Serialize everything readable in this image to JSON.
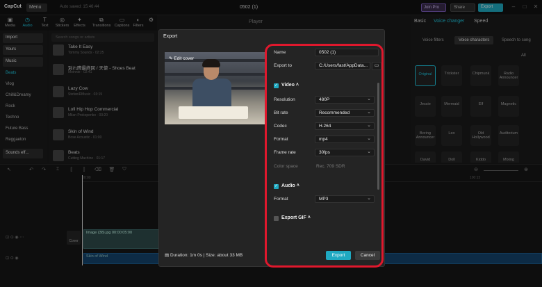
{
  "app": {
    "logo": "CapCut",
    "menu": "Menu",
    "autosave": "Auto saved: 15:46:44",
    "project_title": "0502 (1)",
    "join_pro": "Join Pro",
    "share": "Share",
    "export": "Export"
  },
  "tool_tabs": [
    {
      "label": "Media",
      "icon": "▣"
    },
    {
      "label": "Audio",
      "icon": "◷"
    },
    {
      "label": "Text",
      "icon": "T"
    },
    {
      "label": "Stickers",
      "icon": "◎"
    },
    {
      "label": "Effects",
      "icon": "✦"
    },
    {
      "label": "Transitions",
      "icon": "⧉"
    },
    {
      "label": "Captions",
      "icon": "▭"
    },
    {
      "label": "Filters",
      "icon": "◐"
    },
    {
      "label": "Adjustment",
      "icon": "⚙"
    }
  ],
  "sidebar": {
    "items": [
      "Import",
      "Yours",
      "Music",
      "Beats",
      "Vlog",
      "Chill&Dreamy",
      "Rock",
      "Techno",
      "Future Bass",
      "Reggaeton",
      "Sounds eff..."
    ]
  },
  "music": {
    "search_placeholder": "Search songs or artists",
    "tracks": [
      {
        "title": "Take It Easy",
        "sub": "Tommy Sounds · 02:25"
      },
      {
        "title": "別れ際最終回 / 天使 - Shoes Beat",
        "sub": "Moinnie · 02:41"
      },
      {
        "title": "Lazy Cow",
        "sub": "StefaniRMusic · 03:15"
      },
      {
        "title": "Lofi Hip Hop Commercial",
        "sub": "Milan Prokopenko · 03:20"
      },
      {
        "title": "Skin of Wind",
        "sub": "Bose Acoustic · 01:00"
      },
      {
        "title": "Beats",
        "sub": "Cutting Machine · 01:17"
      }
    ]
  },
  "player": {
    "label": "Player"
  },
  "right_panel": {
    "tabs": [
      "Basic",
      "Voice changer",
      "Speed"
    ],
    "subtabs": [
      "Voice filters",
      "Voice characters",
      "Speech to song"
    ],
    "all_label": "All",
    "voices": [
      "Original",
      "Trickster",
      "Chipmunk",
      "Radio Announcer",
      "Jessie",
      "Mermaid",
      "Elf",
      "Magnetic",
      "Boring Announcer",
      "Leo",
      "Old Hollywood",
      "Auditorium",
      "David",
      "Doll",
      "Kiddo",
      "Mixing"
    ]
  },
  "timeline": {
    "video_clip_label": "Image (38).jpg  00:00:05:00",
    "audio_clip_label": "Skin of Wind",
    "cover_label": "Cover",
    "ruler_mark": "00:00",
    "ruler_mark_2": "100:15"
  },
  "dialog": {
    "title": "Export",
    "edit_cover": "Edit cover",
    "name_label": "Name",
    "name_value": "0502 (1)",
    "export_to_label": "Export to",
    "export_to_value": "C:/Users/fast/AppData...",
    "video_section": "Video",
    "resolution_label": "Resolution",
    "resolution_value": "480P",
    "bitrate_label": "Bit rate",
    "bitrate_value": "Recommended",
    "codec_label": "Codec",
    "codec_value": "H.264",
    "format_label": "Format",
    "format_value": "mp4",
    "framerate_label": "Frame rate",
    "framerate_value": "30fps",
    "colorspace_label": "Color space",
    "colorspace_value": "Rec. 709 SDR",
    "audio_section": "Audio",
    "audio_format_label": "Format",
    "audio_format_value": "MP3",
    "gif_section": "Export GIF",
    "duration": "Duration: 1m 0s | Size: about 33 MB",
    "export_button": "Export",
    "cancel_button": "Cancel"
  },
  "colors": {
    "accent": "#1fa9c1",
    "highlight": "#e0182d"
  }
}
